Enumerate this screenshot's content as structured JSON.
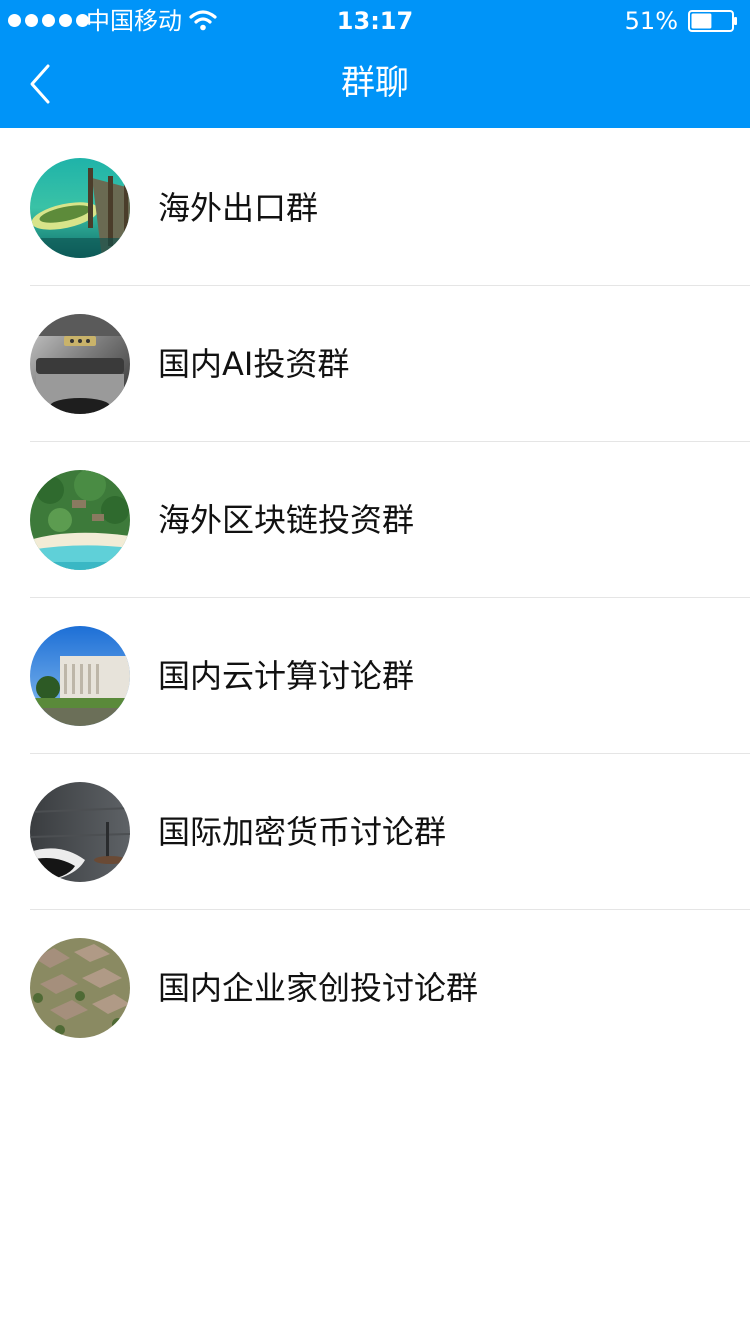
{
  "status_bar": {
    "carrier": "中国移动",
    "time": "13:17",
    "battery_percent": "51%",
    "battery_level": 0.51,
    "signal_strength": 5,
    "wifi_icon": "wifi-icon"
  },
  "nav": {
    "title": "群聊",
    "back_icon": "chevron-left-icon"
  },
  "colors": {
    "header_bg": "#0094f8",
    "text_primary": "#111111",
    "divider": "#e5e5e5"
  },
  "groups": [
    {
      "name": "海外出口群",
      "avatar": "boat-dock-photo"
    },
    {
      "name": "国内AI投资群",
      "avatar": "metal-machine-photo"
    },
    {
      "name": "海外区块链投资群",
      "avatar": "island-resort-photo"
    },
    {
      "name": "国内云计算讨论群",
      "avatar": "classical-building-photo"
    },
    {
      "name": "国际加密货币讨论群",
      "avatar": "dark-interior-photo"
    },
    {
      "name": "国内企业家创投讨论群",
      "avatar": "suburban-houses-photo"
    }
  ]
}
